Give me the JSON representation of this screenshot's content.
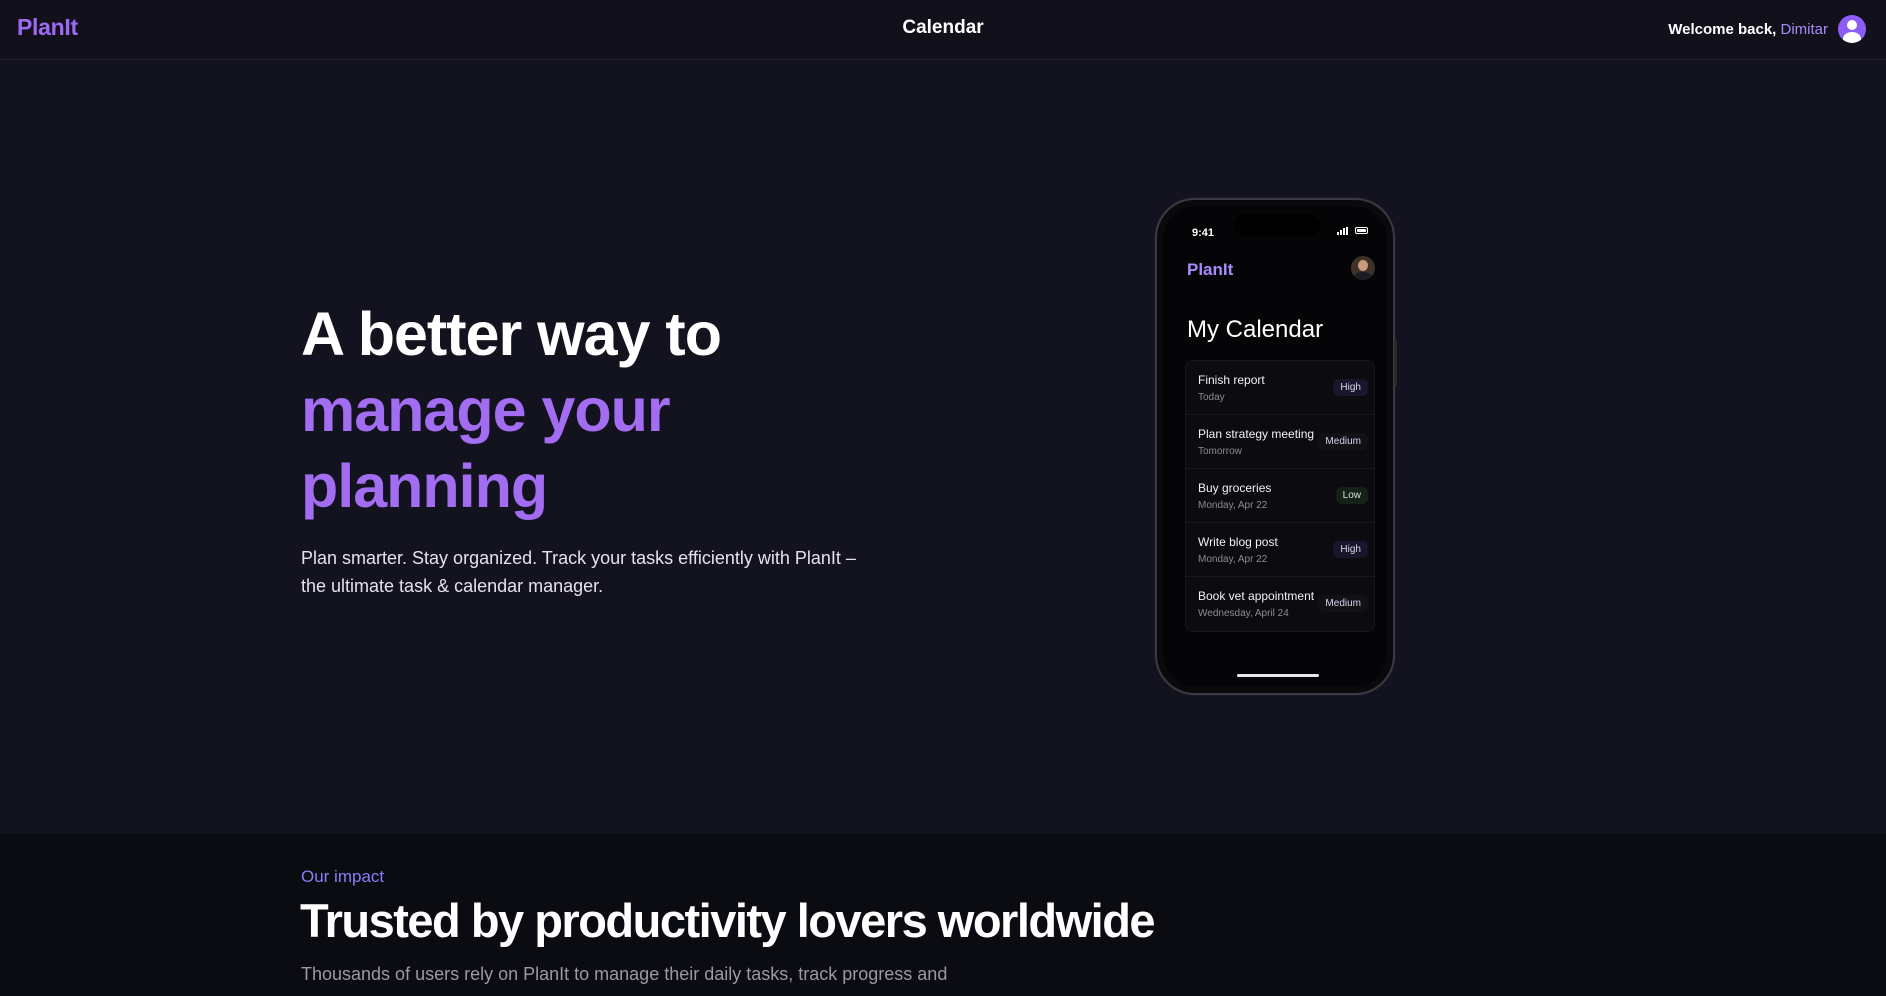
{
  "header": {
    "logo": "PlanIt",
    "title": "Calendar",
    "welcome": "Welcome back,",
    "user_name": "Dimitar",
    "avatar_icon": "user-avatar-icon"
  },
  "hero": {
    "title_line1": "A better way to",
    "title_line2": "manage your",
    "title_line3": "planning",
    "subtitle": "Plan smarter. Stay organized. Track your tasks efficiently with PlanIt – the ultimate task & calendar manager."
  },
  "phone": {
    "status_time": "9:41",
    "app_logo": "PlanIt",
    "heading": "My Calendar",
    "tasks": [
      {
        "title": "Finish report",
        "date": "Today",
        "priority": "High"
      },
      {
        "title": "Plan strategy meeting",
        "date": "Tomorrow",
        "priority": "Medium"
      },
      {
        "title": "Buy groceries",
        "date": "Monday, Apr 22",
        "priority": "Low"
      },
      {
        "title": "Write blog post",
        "date": "Monday, Apr 22",
        "priority": "High"
      },
      {
        "title": "Book vet appointment",
        "date": "Wednesday, April 24",
        "priority": "Medium"
      }
    ]
  },
  "impact": {
    "eyebrow": "Our impact",
    "title": "Trusted by productivity lovers worldwide",
    "subtitle": "Thousands of users rely on PlanIt to manage their daily tasks, track progress and"
  },
  "colors": {
    "accent": "#a26df0",
    "background": "#13121f",
    "header_bg": "#11101b"
  }
}
